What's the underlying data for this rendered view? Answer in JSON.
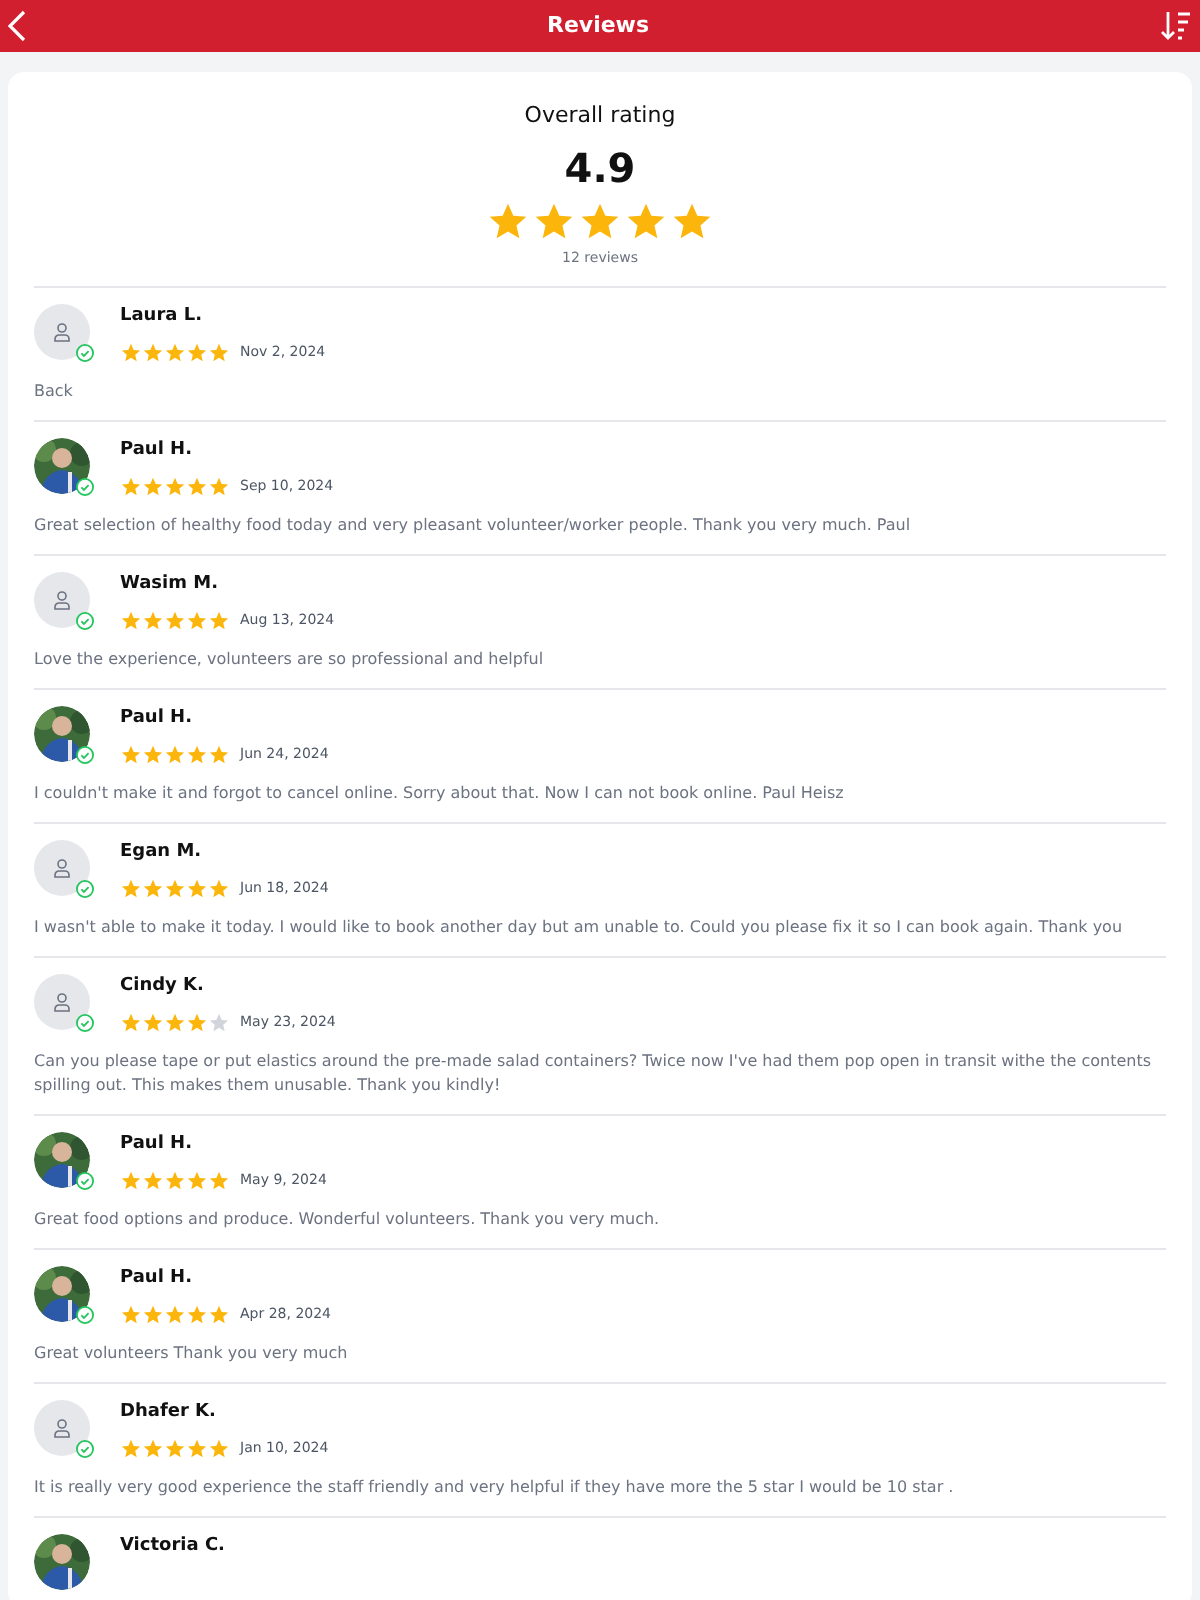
{
  "header": {
    "title": "Reviews"
  },
  "summary": {
    "label": "Overall rating",
    "score": "4.9",
    "stars": 5,
    "count": "12 reviews"
  },
  "reviews": [
    {
      "name": "Laura L.",
      "avatar": {
        "kind": "placeholder"
      },
      "verified": true,
      "stars": 5,
      "date": "Nov 2, 2024",
      "text": "Back"
    },
    {
      "name": "Paul H.",
      "verified": true,
      "stars": 5,
      "date": "Sep 10, 2024",
      "text": "Great selection of healthy food today and very pleasant volunteer/worker people. Thank you very much. Paul"
    },
    {
      "name": "Wasim M.",
      "avatar": {
        "kind": "placeholder"
      },
      "verified": true,
      "stars": 5,
      "date": "Aug 13, 2024",
      "text": "Love the experience, volunteers are so professional and helpful"
    },
    {
      "name": "Paul H.",
      "verified": true,
      "stars": 5,
      "date": "Jun 24, 2024",
      "text": "I couldn't make it and forgot to cancel online. Sorry about that. Now I can not book online. Paul Heisz"
    },
    {
      "name": "Egan M.",
      "avatar": {
        "kind": "placeholder"
      },
      "verified": true,
      "stars": 5,
      "date": "Jun 18, 2024",
      "text": "I wasn't able to make it today. I would like to book another day but am unable to. Could you please fix it so I can book again. Thank you"
    },
    {
      "name": "Cindy K.",
      "avatar": {
        "kind": "placeholder"
      },
      "verified": true,
      "stars": 4,
      "date": "May 23, 2024",
      "text": "Can you please tape or put elastics around the pre-made salad containers? Twice now I've had them pop open in transit withe the contents spilling out. This makes them unusable. Thank you kindly!"
    },
    {
      "name": "Paul H.",
      "verified": true,
      "stars": 5,
      "date": "May 9, 2024",
      "text": "Great food options and produce. Wonderful volunteers. Thank you very much."
    },
    {
      "name": "Paul H.",
      "verified": true,
      "stars": 5,
      "date": "Apr 28, 2024",
      "text": "Great volunteers Thank you very much"
    },
    {
      "name": "Dhafer K.",
      "avatar": {
        "kind": "placeholder"
      },
      "verified": true,
      "stars": 5,
      "date": "Jan 10, 2024",
      "text": "It is really very good experience the staff friendly and very helpful if they have more the 5 star I would be 10 star ."
    },
    {
      "name": "Victoria C."
    }
  ]
}
